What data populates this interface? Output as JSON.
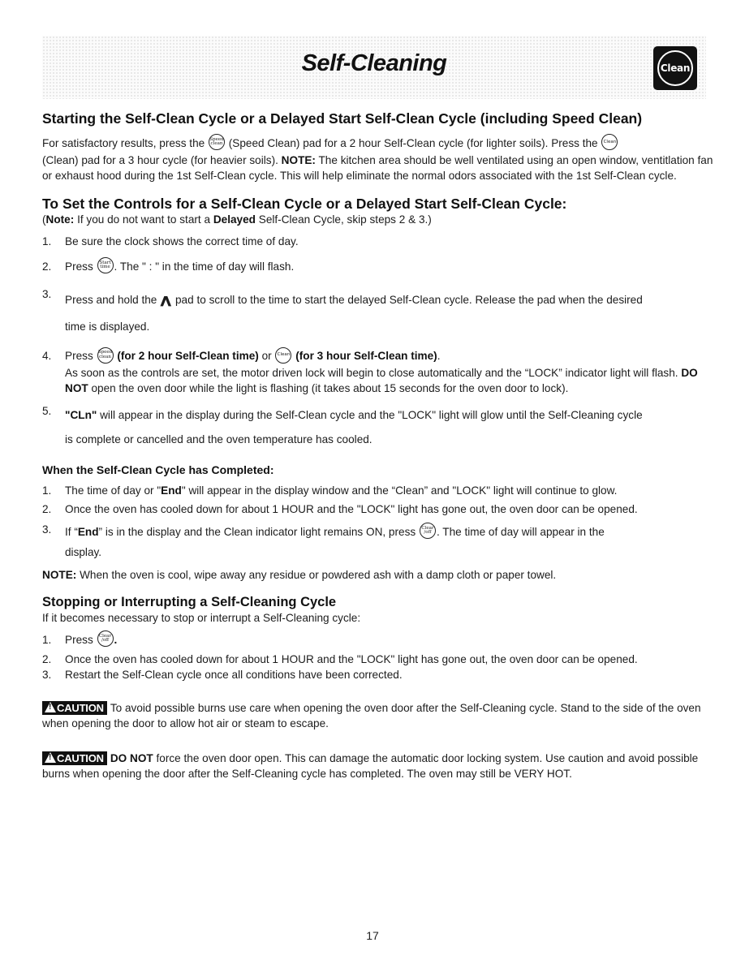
{
  "header": {
    "title": "Self-Cleaning",
    "badge_label": "Clean"
  },
  "pads": {
    "speed_clean": [
      "Speed",
      "clean"
    ],
    "clean": "Clean",
    "start_time": [
      "Start",
      "time"
    ],
    "clear_off": [
      "Clear",
      "/off"
    ]
  },
  "section1": {
    "heading": "Starting the Self-Clean Cycle or a Delayed Start Self-Clean Cycle (including Speed Clean)",
    "p_a": "For satisfactory results, press the",
    "p_b": "(Speed Clean) pad for a 2 hour Self-Clean cycle (for lighter soils). Press the",
    "p_c": "(Clean) pad for a 3 hour cycle (for heavier soils).",
    "note_label": "NOTE:",
    "p_d": "The kitchen area should be well ventilated using an open window, ventitlation fan or exhaust hood during the 1st Self-Clean cycle. This will help eliminate the normal odors associated with the 1st Self-Clean cycle."
  },
  "section2": {
    "heading": "To Set the Controls for a Self-Clean Cycle or a Delayed Start Self-Clean Cycle:",
    "note_open": "(",
    "note_label": "Note:",
    "note_a": "If you do not want to start a",
    "note_bold": "Delayed",
    "note_b": "Self-Clean Cycle, skip steps 2 & 3.)",
    "steps": [
      {
        "num": "1.",
        "text": "Be sure the clock shows the correct time of day."
      },
      {
        "num": "2.",
        "a": "Press",
        "b": ". The \" : \" in the time of day will flash."
      },
      {
        "num": "3.",
        "a": "Press and hold the",
        "b": "pad to scroll to the time to start the delayed Self-Clean cycle. Release the pad when the desired",
        "c": "time is displayed."
      },
      {
        "num": "4.",
        "a": "Press",
        "b": "(for 2 hour Self-Clean time)",
        "c": "or",
        "d": "(for 3 hour Self-Clean time)",
        "e": ".",
        "f": "As soon as the controls are set, the motor driven lock will begin to close automatically and the “LOCK” indicator light will flash.",
        "g": "DO NOT",
        "h": "open the oven door while the light is flashing (it takes about 15 seconds for the oven door to lock)."
      },
      {
        "num": "5.",
        "a": "\"CLn\"",
        "b": "will appear in the display during the Self-Clean cycle and the \"LOCK\" light will glow until the Self-Cleaning cycle",
        "c": "is complete or cancelled and the oven temperature has cooled."
      }
    ]
  },
  "section3": {
    "heading": "When the Self-Clean Cycle has Completed:",
    "steps": [
      {
        "num": "1.",
        "a": "The time of day  or \"",
        "b": "End",
        "c": "\" will appear in the display window and the “Clean” and \"LOCK\" light will continue to glow."
      },
      {
        "num": "2.",
        "text": "Once the oven has cooled down for about 1 HOUR and the \"LOCK\" light has gone out, the oven door can be opened."
      },
      {
        "num": "3.",
        "a": "If “",
        "b": "End",
        "c": "” is in the display and the Clean indicator light remains ON, press",
        "d": ".  The time of day will appear in the",
        "e": "display."
      }
    ],
    "note_label": "NOTE:",
    "note_text": "When the oven is cool, wipe away any residue or powdered ash with a damp cloth or paper towel."
  },
  "section4": {
    "heading": "Stopping or Interrupting a Self-Cleaning Cycle",
    "intro": "If it becomes necessary to stop or interrupt a Self-Cleaning cycle:",
    "steps": [
      {
        "num": "1.",
        "a": "Press",
        "b": "."
      },
      {
        "num": "2.",
        "text": "Once the oven has cooled down for about 1 HOUR and the \"LOCK\" light has gone out, the oven door can be opened."
      },
      {
        "num": "3.",
        "text": "Restart the Self-Clean cycle once all conditions have been corrected."
      }
    ]
  },
  "cautions": [
    {
      "label": "CAUTION",
      "text": "To avoid possible burns use care when opening the oven door after the Self-Cleaning cycle. Stand to the side of the oven when opening the door to allow hot air or steam to escape."
    },
    {
      "label": "CAUTION",
      "bold": "DO NOT",
      "text": "force the oven door open. This can damage the automatic door locking system. Use caution and avoid possible burns when opening the door after the Self-Cleaning cycle has completed. The oven may still be VERY HOT."
    }
  ],
  "footer": {
    "page_number": "17"
  }
}
